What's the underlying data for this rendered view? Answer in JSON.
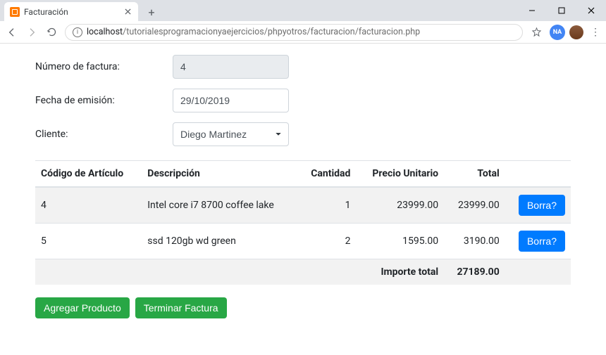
{
  "browser": {
    "tab_title": "Facturación",
    "url_domain": "localhost",
    "url_path": "/tutorialesprogramacionyaejercicios/phpyotros/facturacion/facturacion.php"
  },
  "form": {
    "invoice_label": "Número de factura:",
    "invoice_value": "4",
    "date_label": "Fecha de emisión:",
    "date_value": "29/10/2019",
    "client_label": "Cliente:",
    "client_value": "Diego Martinez"
  },
  "table": {
    "headers": {
      "code": "Código de Artículo",
      "desc": "Descripción",
      "qty": "Cantidad",
      "unit": "Precio Unitario",
      "total": "Total"
    },
    "rows": [
      {
        "code": "4",
        "desc": "Intel core i7 8700 coffee lake",
        "qty": "1",
        "unit": "23999.00",
        "total": "23999.00"
      },
      {
        "code": "5",
        "desc": "ssd 120gb wd green",
        "qty": "2",
        "unit": "1595.00",
        "total": "3190.00"
      }
    ],
    "footer_label": "Importe total",
    "footer_total": "27189.00",
    "delete_label": "Borra?"
  },
  "actions": {
    "add": "Agregar Producto",
    "finish": "Terminar Factura"
  }
}
